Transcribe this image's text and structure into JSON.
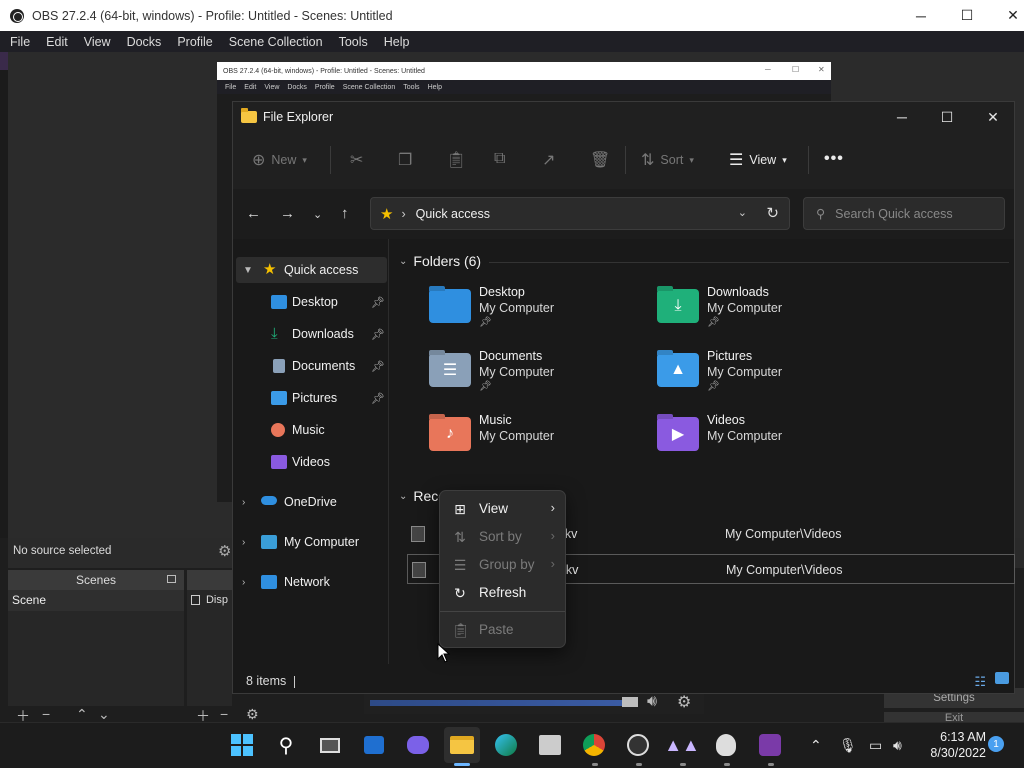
{
  "obs": {
    "title": "OBS 27.2.4 (64-bit, windows) - Profile: Untitled - Scenes: Untitled",
    "menu": [
      "File",
      "Edit",
      "View",
      "Docks",
      "Profile",
      "Scene Collection",
      "Tools",
      "Help"
    ],
    "status_text": "No source selected",
    "scenes_header": "Scenes",
    "scene_item": "Scene",
    "source_item": "Disp",
    "settings_label": "Settings",
    "exit_label": "Exit"
  },
  "nested_obs": {
    "title": "OBS 27.2.4 (64-bit, windows) - Profile: Untitled - Scenes: Untitled",
    "menu": [
      "File",
      "Edit",
      "View",
      "Docks",
      "Profile",
      "Scene Collection",
      "Tools",
      "Help"
    ]
  },
  "explorer": {
    "title": "File Explorer",
    "commands": {
      "new": "New",
      "sort": "Sort",
      "view": "View"
    },
    "address": "Quick access",
    "search_placeholder": "Search Quick access",
    "sidebar": [
      {
        "label": "Quick access",
        "icon": "star-icon",
        "pinned": false
      },
      {
        "label": "Desktop",
        "icon": "desktop-icon",
        "pinned": true
      },
      {
        "label": "Downloads",
        "icon": "download-icon",
        "pinned": true
      },
      {
        "label": "Documents",
        "icon": "document-icon",
        "pinned": true
      },
      {
        "label": "Pictures",
        "icon": "picture-icon",
        "pinned": true
      },
      {
        "label": "Music",
        "icon": "music-icon",
        "pinned": false
      },
      {
        "label": "Videos",
        "icon": "video-icon",
        "pinned": false
      },
      {
        "label": "OneDrive",
        "icon": "cloud-icon",
        "pinned": false
      },
      {
        "label": "My Computer",
        "icon": "computer-icon",
        "pinned": false
      },
      {
        "label": "Network",
        "icon": "network-icon",
        "pinned": false
      }
    ],
    "folders_header": "Folders (6)",
    "folders": [
      {
        "name": "Desktop",
        "location": "My Computer",
        "pinned": true,
        "color": "#2f8fe0"
      },
      {
        "name": "Downloads",
        "location": "My Computer",
        "pinned": true,
        "color": "#1fb07a"
      },
      {
        "name": "Documents",
        "location": "My Computer",
        "pinned": true,
        "color": "#8aa0b8"
      },
      {
        "name": "Pictures",
        "location": "My Computer",
        "pinned": true,
        "color": "#3b9be8"
      },
      {
        "name": "Music",
        "location": "My Computer",
        "pinned": false,
        "color": "#e8765a"
      },
      {
        "name": "Videos",
        "location": "My Computer",
        "pinned": false,
        "color": "#8a5ae0"
      }
    ],
    "recent_header": "Rece",
    "recent_files": [
      {
        "name": ".mkv",
        "location": "My Computer\\Videos"
      },
      {
        "name": ".mkv",
        "location": "My Computer\\Videos"
      }
    ],
    "item_count": "8 items"
  },
  "context_menu": {
    "items": [
      {
        "label": "View",
        "icon": "grid-icon",
        "enabled": true,
        "submenu": true
      },
      {
        "label": "Sort by",
        "icon": "sort-icon",
        "enabled": false,
        "submenu": true
      },
      {
        "label": "Group by",
        "icon": "group-icon",
        "enabled": false,
        "submenu": true
      },
      {
        "label": "Refresh",
        "icon": "refresh-icon",
        "enabled": true,
        "submenu": false
      },
      {
        "label": "Paste",
        "icon": "paste-icon",
        "enabled": false,
        "submenu": false
      }
    ]
  },
  "taskbar": {
    "time": "6:13 AM",
    "date": "8/30/2022",
    "notification_count": "1",
    "accent": "#6cb6ff"
  }
}
